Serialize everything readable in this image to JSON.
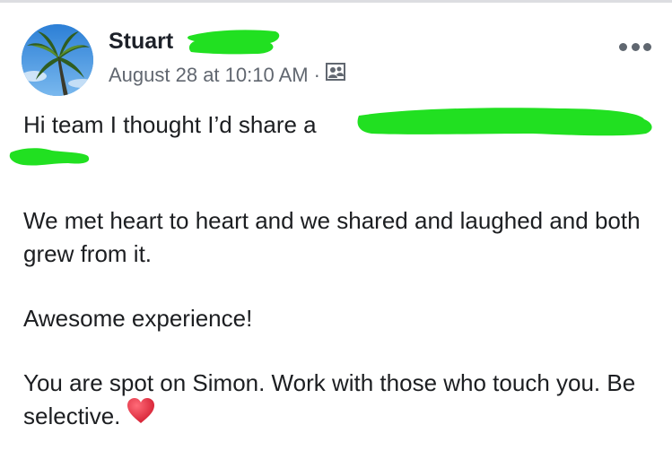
{
  "post": {
    "author_name": "Stuart",
    "timestamp": "August 28 at 10:10 AM",
    "separator": "·",
    "audience_icon": "friends-icon",
    "more_icon": "more-horizontal-icon",
    "body_line_1": "Hi team I thought I’d share a",
    "paragraph_2": "We met heart to heart and we shared and laughed and both grew from it.",
    "paragraph_3": "Awesome experience!",
    "paragraph_4": "You are spot on Simon. Work with those who touch you. Be selective.",
    "emoji": "heart-icon"
  },
  "colors": {
    "redaction": "#21e021",
    "meta_text": "#616770",
    "body_text": "#1c1e21",
    "heart": "#e0243a"
  }
}
